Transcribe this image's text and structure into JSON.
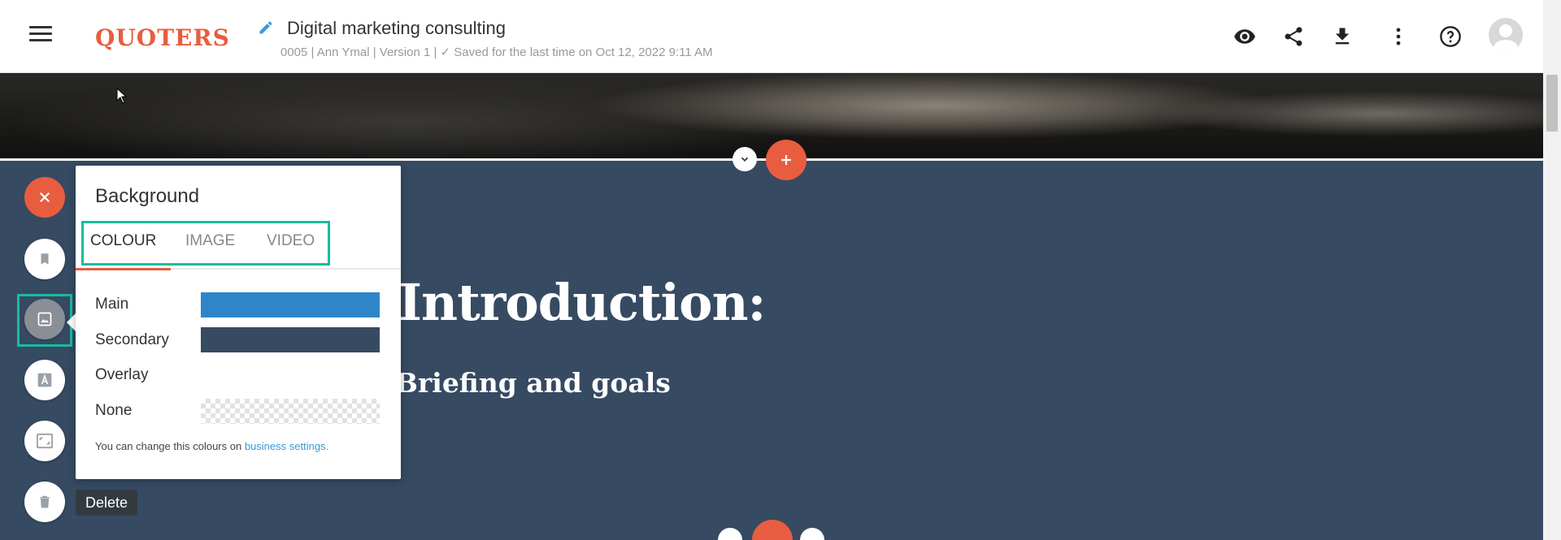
{
  "header": {
    "logo": "QUOTERS",
    "title": "Digital marketing consulting",
    "meta_prefix": "0005 | Ann Ymal | Version 1 | ",
    "meta_check": "✓",
    "meta_saved": "Saved for the last time on Oct 12, 2022 9:11 AM",
    "icons": [
      "menu-icon",
      "edit-pencil-icon",
      "preview-eye-icon",
      "share-icon",
      "download-icon",
      "more-vert-icon",
      "help-icon",
      "user-avatar"
    ]
  },
  "section": {
    "headline": "Introduction:",
    "subheadline": "Briefing and goals"
  },
  "toolbar": {
    "icons": [
      "close-icon",
      "bookmark-icon",
      "image-icon",
      "text-format-icon",
      "layout-icon",
      "trash-icon"
    ],
    "tooltip": "Delete"
  },
  "panel": {
    "title": "Background",
    "tabs": [
      "COLOUR",
      "IMAGE",
      "VIDEO"
    ],
    "active_tab": "COLOUR",
    "rows": [
      {
        "label": "Main",
        "color": "#2e86c9"
      },
      {
        "label": "Secondary",
        "color": "#364a62"
      },
      {
        "label": "Overlay",
        "color": ""
      },
      {
        "label": "None",
        "color": "checkered"
      }
    ],
    "note_text": "You can change this colours on ",
    "note_link": "business settings."
  },
  "colors": {
    "brand": "#e85d3f",
    "section_bg": "#364a62",
    "highlight": "#1abc9c",
    "link": "#3a9ad9"
  }
}
